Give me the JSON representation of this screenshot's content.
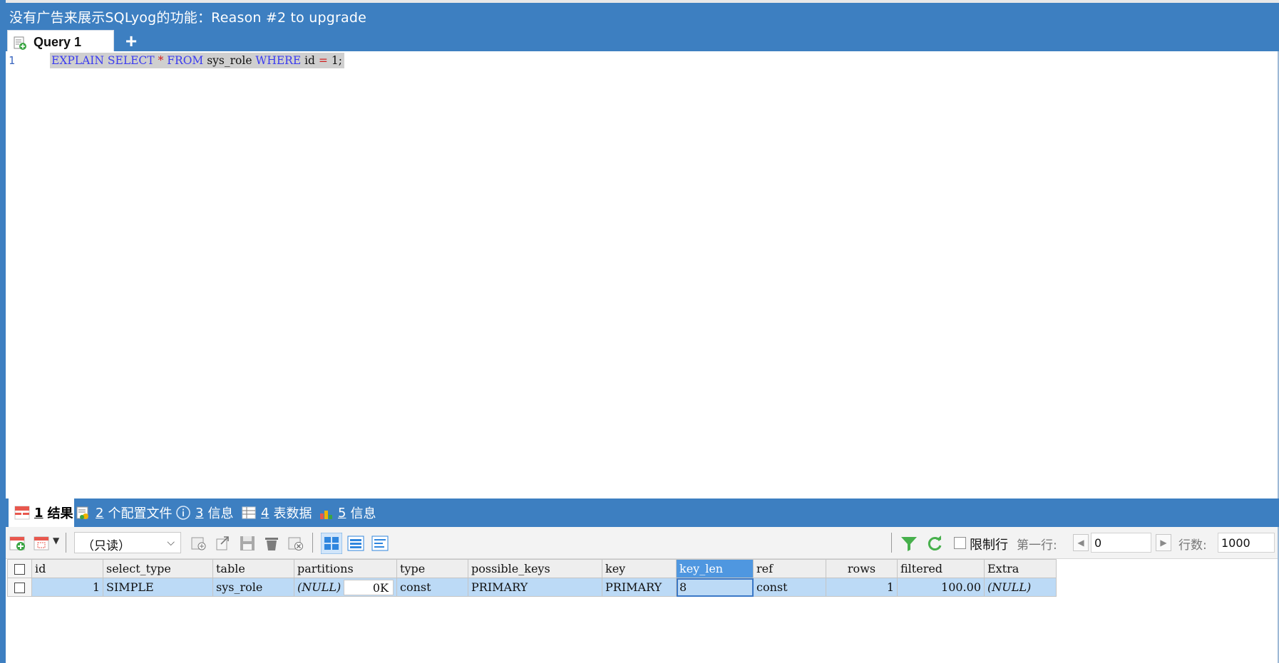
{
  "header": {
    "ad_text": "没有广告来展示SQLyog的功能：Reason #2 to upgrade"
  },
  "query_tabs": {
    "active_label": "Query 1",
    "add_symbol": "+"
  },
  "editor": {
    "line_number": "1",
    "tokens": [
      {
        "text": "EXPLAIN",
        "kind": "kw"
      },
      {
        "text": " ",
        "kind": "tx"
      },
      {
        "text": "SELECT",
        "kind": "kw"
      },
      {
        "text": " ",
        "kind": "tx"
      },
      {
        "text": "*",
        "kind": "op"
      },
      {
        "text": " ",
        "kind": "tx"
      },
      {
        "text": "FROM",
        "kind": "kw"
      },
      {
        "text": " sys_role ",
        "kind": "tx"
      },
      {
        "text": "WHERE",
        "kind": "kw"
      },
      {
        "text": " id ",
        "kind": "tx"
      },
      {
        "text": "=",
        "kind": "op"
      },
      {
        "text": " 1;",
        "kind": "tx"
      }
    ]
  },
  "result_tabs": [
    {
      "num": "1",
      "label": "结果",
      "icon": "result-grid-icon"
    },
    {
      "num": "2",
      "label": "个配置文件",
      "icon": "profile-icon"
    },
    {
      "num": "3",
      "label": "信息",
      "icon": "info-icon"
    },
    {
      "num": "4",
      "label": "表数据",
      "icon": "table-data-icon"
    },
    {
      "num": "5",
      "label": "信息",
      "icon": "info-chart-icon"
    }
  ],
  "toolbar": {
    "readonly_value": "（只读）",
    "limit_label": "限制行",
    "first_row_label": "第一行:",
    "first_row_value": "0",
    "row_count_label": "行数:",
    "row_count_value": "1000"
  },
  "grid": {
    "columns": [
      "id",
      "select_type",
      "table",
      "partitions",
      "type",
      "possible_keys",
      "key",
      "key_len",
      "ref",
      "rows",
      "filtered",
      "Extra"
    ],
    "selected_column": "key_len",
    "row": {
      "id": "1",
      "select_type": "SIMPLE",
      "table": "sys_role",
      "partitions": "(NULL)",
      "partitions_size": "0K",
      "type": "const",
      "possible_keys": "PRIMARY",
      "key": "PRIMARY",
      "key_len": "8",
      "ref": "const",
      "rows": "1",
      "filtered": "100.00",
      "Extra": "(NULL)"
    }
  },
  "colors": {
    "accent_blue": "#3d7fc1",
    "row_selected": "#bcdaf6",
    "header_selected": "#4f97e0"
  }
}
